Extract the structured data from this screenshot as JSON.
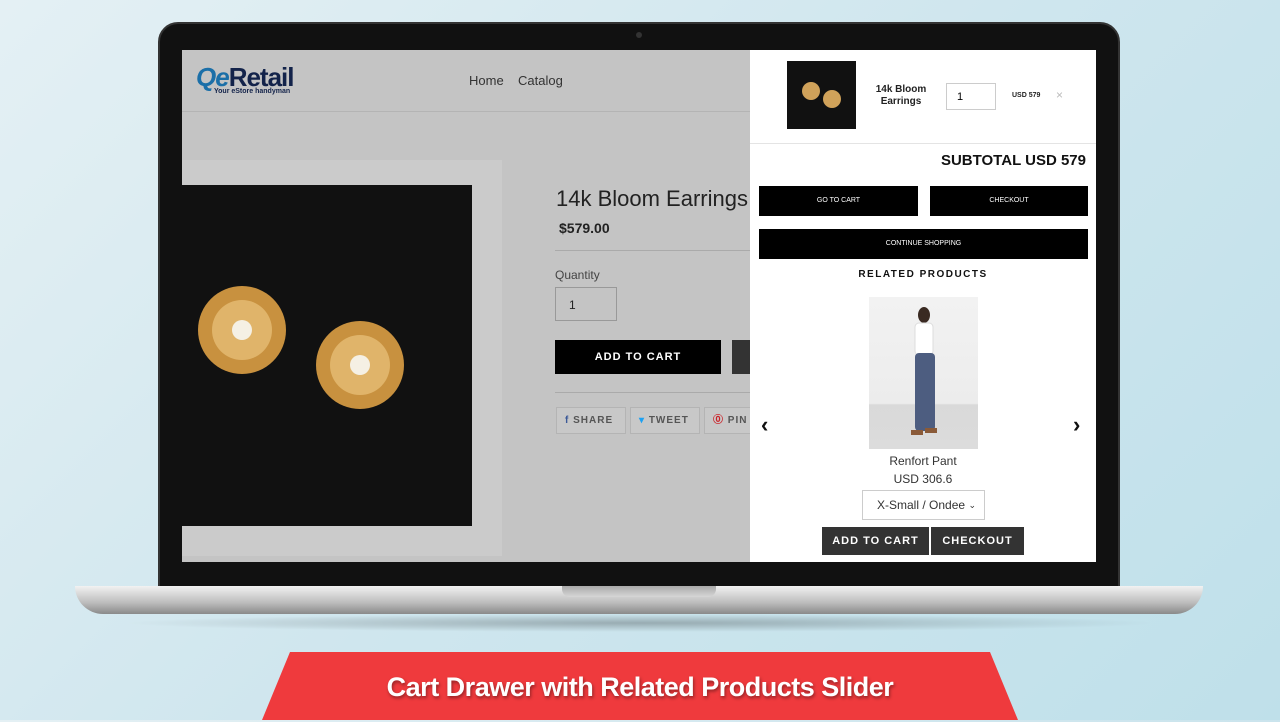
{
  "banner": {
    "title": "Cart Drawer with Related Products Slider",
    "color": "#ef3a3d"
  },
  "store": {
    "logo": "QeRetail",
    "tagline": "Your eStore handyman",
    "nav": [
      "Home",
      "Catalog"
    ]
  },
  "product": {
    "title": "14k Bloom Earrings",
    "price": "$579.00",
    "quantity_label": "Quantity",
    "quantity": "1",
    "add_to_cart": "ADD TO CART",
    "share": [
      "SHARE",
      "TWEET",
      "PIN"
    ]
  },
  "cart": {
    "item": {
      "name": "14k Bloom Earrings",
      "quantity": "1",
      "price": "USD 579"
    },
    "close": "×",
    "subtotal": "SUBTOTAL USD 579",
    "go_to_cart": "GO TO CART",
    "checkout": "CHECKOUT",
    "continue": "CONTINUE SHOPPING"
  },
  "related": {
    "heading": "RELATED PRODUCTS",
    "prev": "‹",
    "next": "›",
    "items": [
      {
        "name": "Renfort Pant",
        "price": "USD 306.6",
        "variant": "X-Small / Ondee",
        "add_to_cart": "ADD TO CART",
        "checkout": "CHECKOUT"
      }
    ]
  }
}
